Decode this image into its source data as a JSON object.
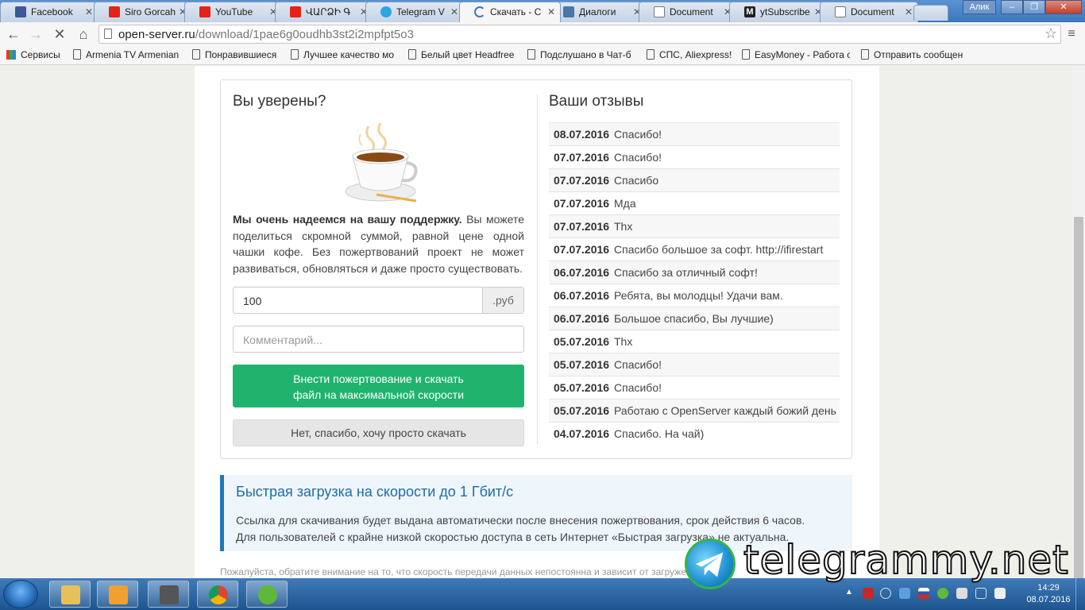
{
  "browser": {
    "tabs": [
      {
        "label": "Facebook",
        "icon": "facebook-icon",
        "color": "#3b5998"
      },
      {
        "label": "Siro Gorcah",
        "icon": "youtube-icon",
        "color": "#e62117"
      },
      {
        "label": "YouTube",
        "icon": "youtube-icon",
        "color": "#e62117"
      },
      {
        "label": "ՎԱՐՁԻ Գ",
        "icon": "youtube-icon",
        "color": "#e62117"
      },
      {
        "label": "Telegram V",
        "icon": "telegram-icon",
        "color": "#2ca5e0"
      },
      {
        "label": "Скачать - С",
        "icon": "loading-icon",
        "color": "#3a78bd"
      },
      {
        "label": "Диалоги",
        "icon": "vk-icon",
        "color": "#4a76a8"
      },
      {
        "label": "Document",
        "icon": "document-icon",
        "color": "#ffffff"
      },
      {
        "label": "ytSubscribe",
        "icon": "medium-icon",
        "color": "#222222"
      },
      {
        "label": "Document",
        "icon": "document-icon",
        "color": "#ffffff"
      }
    ],
    "user": "Алик",
    "url_host": "open-server.ru",
    "url_path": "/download/1pae6g0oudhb3st2i2mpfpt5o3",
    "bookmarks": [
      "Сервисы",
      "Armenia TV Armenian",
      "Понравившиеся",
      "Лучшее качество мо",
      "Белый цвет Headfree",
      "Подслушано в Чат-б",
      "СПС, Aliexpress!",
      "EasyMoney - Работа с",
      "Отправить сообщен"
    ]
  },
  "donate": {
    "title": "Вы уверены?",
    "lead_bold": "Мы очень надеемся на вашу поддержку.",
    "lead_rest": " Вы можете поделиться скромной суммой, равной цене одной чашки кофе. Без пожертвований проект не может развиваться, обновляться и даже просто существовать.",
    "amount_value": "100",
    "amount_unit": ".руб",
    "comment_placeholder": "Комментарий...",
    "donate_button_line1": "Внести пожертвование и скачать",
    "donate_button_line2": "файл на максимальной скорости",
    "skip_button": "Нет, спасибо, хочу просто скачать"
  },
  "reviews": {
    "title": "Ваши отзывы",
    "items": [
      {
        "date": "08.07.2016",
        "text": "Спасибо!"
      },
      {
        "date": "07.07.2016",
        "text": "Спасибо!"
      },
      {
        "date": "07.07.2016",
        "text": "Спасибо"
      },
      {
        "date": "07.07.2016",
        "text": "Мда"
      },
      {
        "date": "07.07.2016",
        "text": "Thx"
      },
      {
        "date": "07.07.2016",
        "text": "Спасибо большое за софт. http://ifirestart"
      },
      {
        "date": "06.07.2016",
        "text": "Спасибо за отличный софт!"
      },
      {
        "date": "06.07.2016",
        "text": "Ребята, вы молодцы! Удачи вам."
      },
      {
        "date": "06.07.2016",
        "text": "Большое спасибо, Вы лучшие)"
      },
      {
        "date": "05.07.2016",
        "text": "Thx"
      },
      {
        "date": "05.07.2016",
        "text": "Спасибо!"
      },
      {
        "date": "05.07.2016",
        "text": "Спасибо!"
      },
      {
        "date": "05.07.2016",
        "text": "Работаю с OpenServer каждый божий день"
      },
      {
        "date": "04.07.2016",
        "text": "Спасибо. На чай)"
      }
    ]
  },
  "fast": {
    "title": "Быстрая загрузка на скорости до 1 Гбит/с",
    "line1": "Ссылка для скачивания будет выдана автоматически после внесения пожертвования, срок действия 6 часов.",
    "line2": "Для пользователей с крайне низкой скоростью доступа в сеть Интернет «Быстрая загрузка» не актуальна."
  },
  "note": "Пожалуйста, обратите внимание на то, что скорость передачи данных непостоянна и зависит от загруженности",
  "watermark": "telegrammy.net",
  "taskbar": {
    "time": "14:29",
    "date": "08.07.2016"
  },
  "colors": {
    "accent_green": "#1fb36e",
    "accent_blue": "#1f7ab8"
  }
}
